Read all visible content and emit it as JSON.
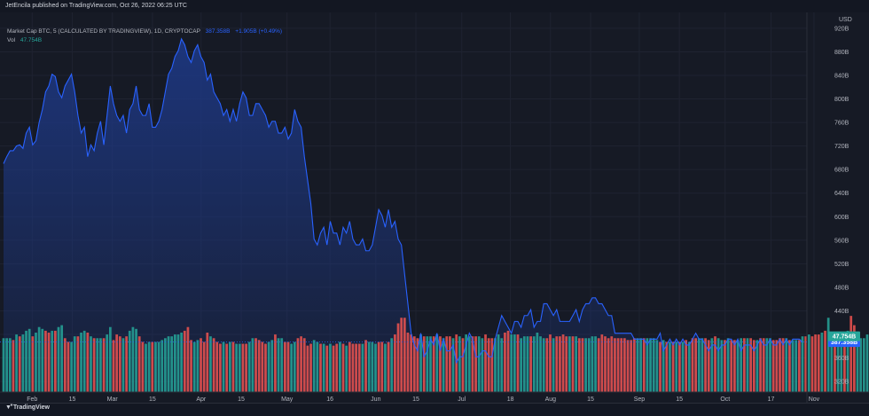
{
  "header": {
    "publish_line": "JetEncila published on TradingView.com, Oct 26, 2022 06:25 UTC"
  },
  "legend": {
    "symbol_line": "Market Cap BTC, 5 (CALCULATED BY TRADINGVIEW), 1D, CRYPTOCAP",
    "price": "387.358B",
    "change": "+1.905B (+0.49%)",
    "volume_label": "Vol",
    "volume_value": "47.754B"
  },
  "footer": {
    "logo_text": "TradingView"
  },
  "colors": {
    "background": "#161a25",
    "line": "#2962ff",
    "area_top": "#1e3a8a",
    "vol_up": "#26a69a",
    "vol_down": "#ef5350",
    "grid": "#1f2331",
    "axis_text": "#b2b5be"
  },
  "chart_data": {
    "type": "area",
    "currency_label": "USD",
    "y_ticks": [
      "320B",
      "360B",
      "400B",
      "440B",
      "480B",
      "520B",
      "560B",
      "600B",
      "640B",
      "680B",
      "720B",
      "760B",
      "800B",
      "840B",
      "880B",
      "920B"
    ],
    "y_tick_values": [
      320,
      360,
      400,
      440,
      480,
      520,
      560,
      600,
      640,
      680,
      720,
      760,
      800,
      840,
      880,
      920
    ],
    "ylim": [
      302,
      947
    ],
    "x_ticks": [
      "Feb",
      "15",
      "Mar",
      "15",
      "Apr",
      "15",
      "May",
      "16",
      "Jun",
      "15",
      "Jul",
      "18",
      "Aug",
      "15",
      "Sep",
      "15",
      "Oct",
      "17",
      "Nov"
    ],
    "x_tick_days": [
      0,
      14,
      28,
      42,
      59,
      73,
      89,
      104,
      120,
      134,
      150,
      167,
      181,
      195,
      212,
      226,
      242,
      258,
      273
    ],
    "x_range_days": [
      -10,
      269
    ],
    "market_cap_B": [
      690,
      702,
      712,
      712,
      720,
      722,
      716,
      742,
      752,
      722,
      729,
      760,
      782,
      812,
      822,
      842,
      838,
      812,
      802,
      822,
      832,
      842,
      812,
      772,
      742,
      752,
      702,
      722,
      712,
      742,
      762,
      722,
      772,
      822,
      792,
      772,
      762,
      772,
      742,
      782,
      792,
      822,
      782,
      772,
      772,
      792,
      752,
      752,
      762,
      782,
      812,
      842,
      852,
      872,
      882,
      902,
      892,
      872,
      862,
      882,
      892,
      872,
      862,
      832,
      842,
      812,
      802,
      792,
      772,
      782,
      762,
      782,
      762,
      792,
      812,
      802,
      772,
      772,
      792,
      792,
      782,
      772,
      752,
      762,
      762,
      742,
      742,
      752,
      732,
      742,
      782,
      762,
      752,
      702,
      662,
      622,
      562,
      552,
      572,
      582,
      552,
      592,
      572,
      572,
      552,
      582,
      572,
      592,
      562,
      552,
      552,
      562,
      542,
      542,
      552,
      582,
      612,
      602,
      582,
      612,
      582,
      592,
      562,
      552,
      502,
      452,
      402,
      382,
      372,
      402,
      362,
      372,
      392,
      382,
      402,
      372,
      392,
      372,
      372,
      382,
      352,
      362,
      362,
      382,
      402,
      392,
      362,
      362,
      372,
      372,
      362,
      362,
      392,
      412,
      432,
      422,
      412,
      402,
      422,
      422,
      412,
      432,
      432,
      442,
      412,
      422,
      422,
      452,
      452,
      442,
      432,
      442,
      422,
      422,
      422,
      422,
      432,
      442,
      422,
      442,
      452,
      452,
      462,
      462,
      452,
      452,
      442,
      432,
      432,
      402,
      402,
      402,
      402,
      402,
      402,
      392,
      392,
      392,
      392,
      382,
      392,
      392,
      392,
      402,
      372,
      382,
      392,
      382,
      392,
      382,
      392,
      382,
      382,
      392,
      402,
      392,
      392,
      382,
      372,
      382,
      382,
      372,
      382,
      382,
      392,
      392,
      382,
      392,
      372,
      382,
      382,
      382,
      372,
      382,
      392,
      382,
      382,
      392,
      382,
      382,
      392,
      382,
      392,
      382,
      392,
      392,
      392,
      387
    ],
    "volume_B": [
      29,
      29,
      29,
      28,
      31,
      30,
      31,
      33,
      34,
      30,
      32,
      35,
      34,
      33,
      32,
      33,
      33,
      35,
      36,
      29,
      27,
      27,
      30,
      30,
      32,
      33,
      32,
      30,
      29,
      29,
      29,
      29,
      31,
      35,
      28,
      31,
      30,
      29,
      30,
      33,
      35,
      34,
      30,
      27,
      26,
      27,
      27,
      27,
      27,
      28,
      29,
      30,
      30,
      31,
      31,
      32,
      33,
      35,
      28,
      27,
      28,
      29,
      27,
      32,
      30,
      29,
      27,
      26,
      27,
      26,
      27,
      27,
      26,
      26,
      26,
      26,
      27,
      29,
      29,
      28,
      27,
      26,
      27,
      28,
      31,
      29,
      29,
      27,
      27,
      26,
      27,
      29,
      30,
      29,
      25,
      26,
      28,
      27,
      26,
      26,
      25,
      26,
      25,
      26,
      27,
      26,
      25,
      27,
      26,
      26,
      26,
      26,
      28,
      27,
      27,
      26,
      27,
      27,
      26,
      27,
      29,
      31,
      37,
      40,
      40,
      32,
      31,
      30,
      29,
      31,
      30,
      30,
      30,
      30,
      31,
      30,
      29,
      30,
      30,
      29,
      31,
      30,
      29,
      31,
      30,
      30,
      30,
      30,
      29,
      31,
      29,
      29,
      29,
      31,
      29,
      32,
      33,
      31,
      31,
      31,
      29,
      30,
      30,
      30,
      30,
      32,
      30,
      29,
      29,
      31,
      29,
      30,
      30,
      31,
      30,
      30,
      30,
      30,
      29,
      29,
      29,
      29,
      30,
      30,
      29,
      31,
      30,
      29,
      30,
      29,
      29,
      29,
      29,
      28,
      28,
      29,
      29,
      29,
      29,
      29,
      29,
      29,
      28,
      27,
      28,
      27,
      27,
      27,
      27,
      27,
      27,
      28,
      27,
      29,
      29,
      29,
      29,
      29,
      28,
      29,
      30,
      29,
      28,
      28,
      29,
      28,
      28,
      28,
      29,
      29,
      29,
      29,
      28,
      28,
      29,
      29,
      29,
      29,
      28,
      28,
      29,
      29,
      29,
      28,
      28,
      28,
      28,
      30,
      30,
      31,
      30,
      31,
      31,
      32,
      33,
      40,
      32,
      31,
      30,
      30,
      32,
      33,
      41,
      36,
      31,
      29,
      29,
      31,
      47.754
    ],
    "volume_up": [
      1,
      1,
      1,
      0,
      1,
      0,
      1,
      1,
      1,
      0,
      1,
      1,
      1,
      0,
      0,
      1,
      0,
      1,
      1,
      0,
      0,
      1,
      1,
      0,
      1,
      1,
      0,
      1,
      0,
      1,
      1,
      0,
      1,
      1,
      0,
      0,
      0,
      1,
      0,
      1,
      1,
      1,
      0,
      0,
      1,
      1,
      0,
      1,
      1,
      1,
      1,
      1,
      1,
      1,
      1,
      1,
      0,
      0,
      0,
      1,
      1,
      0,
      0,
      0,
      1,
      0,
      0,
      0,
      1,
      0,
      1,
      0,
      1,
      1,
      0,
      0,
      1,
      1,
      0,
      0,
      0,
      0,
      1,
      1,
      0,
      1,
      1,
      0,
      0,
      1,
      1,
      0,
      0,
      0,
      0,
      0,
      1,
      1,
      0,
      1,
      0,
      1,
      0,
      0,
      1,
      0,
      1,
      0,
      0,
      0,
      0,
      1,
      0,
      1,
      1,
      1,
      0,
      0,
      1,
      0,
      1,
      0,
      0,
      0,
      0,
      0,
      0,
      0,
      0,
      1,
      0,
      1,
      1,
      0,
      1,
      0,
      1,
      0,
      0,
      1,
      0,
      1,
      0,
      1,
      1,
      0,
      0,
      1,
      1,
      0,
      0,
      0,
      1,
      1,
      1,
      0,
      0,
      1,
      1,
      0,
      1,
      1,
      1,
      0,
      1,
      1,
      1,
      1,
      0,
      0,
      1,
      0,
      0,
      0,
      0,
      1,
      0,
      1,
      0,
      0,
      1,
      1,
      1,
      1,
      0,
      0,
      0,
      0,
      0,
      0,
      0,
      0,
      0,
      0,
      0,
      0,
      1,
      1,
      0,
      1,
      1,
      1,
      1,
      0,
      1,
      0,
      1,
      0,
      1,
      0,
      1,
      0,
      1,
      0,
      0,
      1,
      1,
      0,
      0,
      1,
      0,
      1,
      1,
      0,
      1,
      0,
      0,
      1,
      1,
      0,
      1,
      0,
      0,
      1,
      0,
      0,
      1,
      1,
      0,
      0,
      0,
      0,
      1,
      0,
      1,
      1,
      0,
      1,
      0,
      1,
      0,
      0,
      0,
      1,
      0,
      1,
      1,
      0,
      1,
      1,
      0,
      1,
      0,
      0,
      1,
      1,
      1,
      1,
      0,
      1,
      1,
      1,
      1
    ],
    "last_price_label": "387.358B",
    "last_volume_label": "47.754B",
    "grid": true
  }
}
